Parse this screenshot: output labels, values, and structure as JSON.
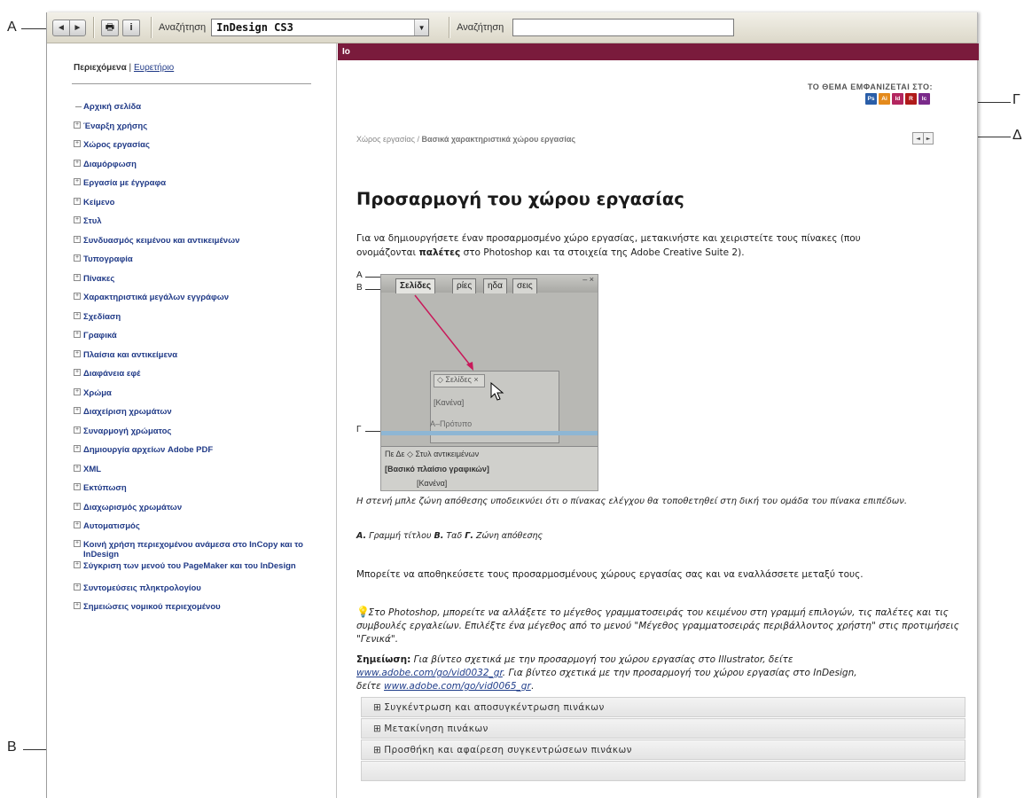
{
  "callouts": {
    "a": "A",
    "b": "B",
    "g": "Γ",
    "d": "Δ"
  },
  "toolbar": {
    "back": "◄",
    "forward": "►",
    "print": "🖶",
    "info": "i",
    "scope_label": "Αναζήτηση",
    "scope_value": "InDesign CS3",
    "dropdown_arrow": "▼",
    "search_label": "Αναζήτηση",
    "search_value": ""
  },
  "sidebar": {
    "tab_contents": "Περιεχόμενα",
    "tab_sep": "|",
    "tab_index": "Ευρετήριο",
    "items": [
      {
        "label": "Αρχική σελίδα",
        "expandable": false
      },
      {
        "label": "Έναρξη χρήσης",
        "expandable": true
      },
      {
        "label": "Χώρος εργασίας",
        "expandable": true
      },
      {
        "label": "Διαμόρφωση",
        "expandable": true
      },
      {
        "label": "Εργασία με έγγραφα",
        "expandable": true
      },
      {
        "label": "Κείμενο",
        "expandable": true
      },
      {
        "label": "Στυλ",
        "expandable": true
      },
      {
        "label": "Συνδυασμός κειμένου και αντικειμένων",
        "expandable": true
      },
      {
        "label": "Τυπογραφία",
        "expandable": true
      },
      {
        "label": "Πίνακες",
        "expandable": true
      },
      {
        "label": "Χαρακτηριστικά μεγάλων εγγράφων",
        "expandable": true
      },
      {
        "label": "Σχεδίαση",
        "expandable": true
      },
      {
        "label": "Γραφικά",
        "expandable": true
      },
      {
        "label": "Πλαίσια και αντικείμενα",
        "expandable": true
      },
      {
        "label": "Διαφάνεια εφέ",
        "expandable": true
      },
      {
        "label": "Χρώμα",
        "expandable": true
      },
      {
        "label": "Διαχείριση χρωμάτων",
        "expandable": true
      },
      {
        "label": "Συναρμογή χρώματος",
        "expandable": true
      },
      {
        "label": "Δημιουργία αρχείων Adobe PDF",
        "expandable": true
      },
      {
        "label": "XML",
        "expandable": true
      },
      {
        "label": "Εκτύπωση",
        "expandable": true
      },
      {
        "label": "Διαχωρισμός χρωμάτων",
        "expandable": true
      },
      {
        "label": "Αυτοματισμός",
        "expandable": true
      },
      {
        "label": "Κοινή χρήση περιεχομένου ανάμεσα στο InCopy και το InDesign",
        "expandable": true
      },
      {
        "label": "Σύγκριση των μενού του PageMaker και του InDesign",
        "expandable": true
      },
      {
        "label": "Συντομεύσεις πληκτρολογίου",
        "expandable": true
      },
      {
        "label": "Σημειώσεις νομικού περιεχομένου",
        "expandable": true
      }
    ]
  },
  "content": {
    "header": "Ιο",
    "appears_in": "ΤΟ ΘΕΜΑ ΕΜΦΑΝΙΖΕΤΑΙ ΣΤΟ:",
    "product_icons": [
      {
        "label": "Ps",
        "color": "#2a5ea8"
      },
      {
        "label": "Ai",
        "color": "#e48a1c"
      },
      {
        "label": "Id",
        "color": "#b3265f"
      },
      {
        "label": "R",
        "color": "#b01a1a"
      },
      {
        "label": "Ic",
        "color": "#7a2a8a"
      }
    ],
    "breadcrumb_parent": "Χώρος εργασίας",
    "breadcrumb_sep": " / ",
    "breadcrumb_current": "Βασικά χαρακτηριστικά χώρου εργασίας",
    "prev": "◄",
    "next": "►",
    "title": "Προσαρμογή του χώρου εργασίας",
    "intro_1": "Για να δημιουργήσετε έναν προσαρμοσμένο χώρο εργασίας, μετακινήστε και χειριστείτε τους πίνακες (που",
    "intro_2a": "ονομάζονται ",
    "intro_2b": "παλέτες",
    "intro_2c": " στο Photoshop και τα στοιχεία της Adobe Creative Suite 2).",
    "figure": {
      "label_a": "A",
      "label_b": "B",
      "label_g": "Γ",
      "tab_pages": "Σελίδες",
      "tab_2": "ρίες",
      "tab_3": "ηδα",
      "tab_4": "σεις",
      "close": "– ×",
      "panel_tab": "◇ Σελίδες ×",
      "panel_none": "[Κανένα]",
      "master": "A–Πρότυπο",
      "row_1": "Πε  Δε  ◇ Στυλ αντικειμένων",
      "row_2": "[Βασικό πλαίσιο γραφικών]",
      "row_3": "[Κανένα]"
    },
    "caption": "Η στενή μπλε ζώνη απόθεσης υποδεικνύει ότι ο πίνακας ελέγχου θα τοποθετηθεί στη δική του ομάδα του πίνακα επιπέδων.",
    "legend_a": "A.",
    "legend_a_text": " Γραμμή τίτλου  ",
    "legend_b": "B.",
    "legend_b_text": " Ταδ  ",
    "legend_g": "Γ.",
    "legend_g_text": " Ζώνη απόθεσης",
    "save_text": "Μπορείτε να αποθηκεύσετε τους προσαρμοσμένους χώρους εργασίας σας και να εναλλάσσετε μεταξύ τους.",
    "tip_text": "Στο Photoshop, μπορείτε να αλλάξετε το μέγεθος γραμματοσειράς του κειμένου στη γραμμή επιλογών, τις παλέτες και τις συμβουλές εργαλείων. Επιλέξτε ένα μέγεθος από το μενού \"Μέγεθος γραμματοσειράς περιβάλλοντος χρήστη\" στις προτιμήσεις \"Γενικά\".",
    "note_label": "Σημείωση:",
    "note_1": " Για βίντεο σχετικά με την προσαρμογή του χώρου εργασίας στο Illustrator, δείτε",
    "note_link_1": "www.adobe.com/go/vid0032_gr",
    "note_2": ". Για βίντεο σχετικά με την προσαρμογή του χώρου εργασίας στο InDesign,",
    "note_3": "δείτε ",
    "note_link_2": "www.adobe.com/go/vid0065_gr",
    "note_end": ".",
    "accordion": [
      "Συγκέντρωση και αποσυγκέντρωση πινάκων",
      "Μετακίνηση πινάκων",
      "Προσθήκη και αφαίρεση συγκεντρώσεων πινάκων"
    ],
    "accordion_icon": "⊞"
  }
}
